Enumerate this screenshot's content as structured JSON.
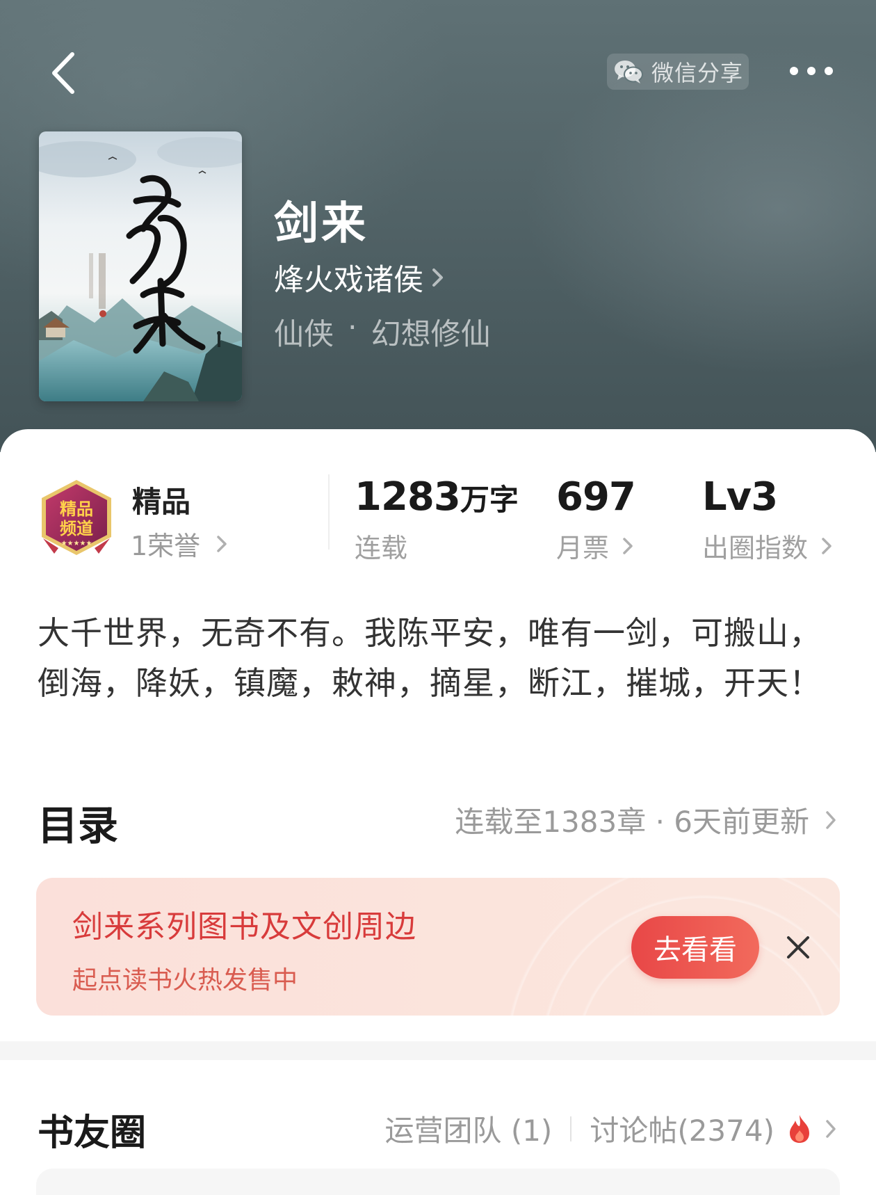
{
  "header": {
    "share_label": "微信分享"
  },
  "book": {
    "title": "剑来",
    "author": "烽火戏诸侯",
    "genre": "仙侠",
    "subgenre": "幻想修仙",
    "genre_separator": "·"
  },
  "badge": {
    "title": "精品",
    "honor": "1荣誉"
  },
  "stats": {
    "words_value": "1283",
    "words_unit": "万字",
    "words_label": "连载",
    "tickets_value": "697",
    "tickets_label": "月票",
    "index_value": "Lv3",
    "index_label": "出圈指数"
  },
  "description": "大千世界，无奇不有。我陈平安，唯有一剑，可搬山，倒海，降妖，镇魔，敕神，摘星，断江，摧城，开天！",
  "toc": {
    "title": "目录",
    "info": "连载至1383章 · 6天前更新"
  },
  "promo": {
    "title": "剑来系列图书及文创周边",
    "subtitle": "起点读书火热发售中",
    "button": "去看看"
  },
  "circle": {
    "title": "书友圈",
    "team": "运营团队 (1)",
    "posts": "讨论帖(2374)"
  },
  "colors": {
    "accent_red": "#e84747",
    "promo_text": "#d83b3b",
    "header_bg": "#56686c"
  }
}
